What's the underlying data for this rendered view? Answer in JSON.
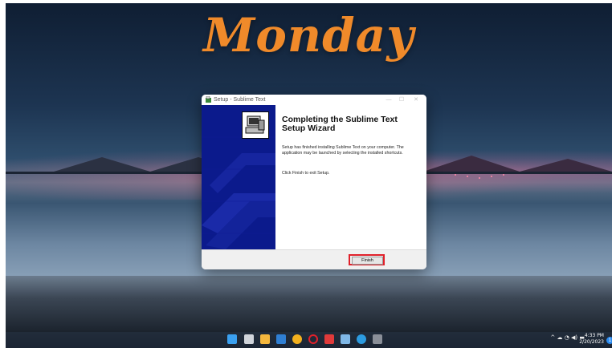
{
  "wallpaper": {
    "title": "Monday"
  },
  "dialog": {
    "window_title": "Setup - Sublime Text",
    "heading": "Completing the Sublime Text Setup Wizard",
    "body": "Setup has finished installing Sublime Text on your computer. The application may be launched by selecting the installed shortcuts.",
    "exit_text": "Click Finish to exit Setup.",
    "finish_label": "Finish"
  },
  "taskbar": {
    "apps": [
      "start",
      "task-view",
      "file-explorer",
      "mail",
      "chrome",
      "opera",
      "wps-office",
      "notepad",
      "telegram",
      "app-installer"
    ],
    "clock_time": "4:33 PM",
    "clock_date": "2/20/2023",
    "notification_count": "1"
  },
  "colors": {
    "accent_orange": "#f08a2a",
    "wizard_blue": "#0b1a8c",
    "highlight_red": "#e0202a"
  }
}
